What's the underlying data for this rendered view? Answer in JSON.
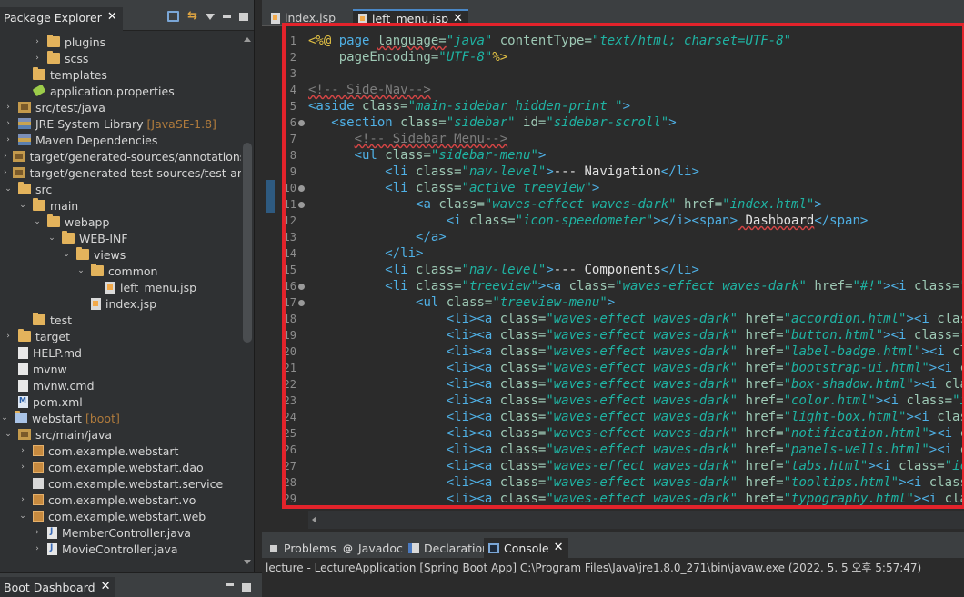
{
  "package_explorer": {
    "title": "Package Explorer",
    "tree": [
      {
        "label": "plugins",
        "suffix": "",
        "icon": "folder"
      },
      {
        "label": "scss",
        "suffix": "",
        "icon": "folder"
      },
      {
        "label": "templates",
        "suffix": "",
        "icon": "folder"
      },
      {
        "label": "application.properties",
        "suffix": "",
        "icon": "properties"
      },
      {
        "label": "src/test/java",
        "suffix": "",
        "icon": "source-folder"
      },
      {
        "label": "JRE System Library",
        "suffix": "[JavaSE-1.8]",
        "icon": "library"
      },
      {
        "label": "Maven Dependencies",
        "suffix": "",
        "icon": "library"
      },
      {
        "label": "target/generated-sources/annotations",
        "suffix": "",
        "icon": "source-folder"
      },
      {
        "label": "target/generated-test-sources/test-annotat",
        "suffix": "",
        "icon": "source-folder"
      },
      {
        "label": "src",
        "suffix": "",
        "icon": "folder"
      },
      {
        "label": "main",
        "suffix": "",
        "icon": "folder"
      },
      {
        "label": "webapp",
        "suffix": "",
        "icon": "folder"
      },
      {
        "label": "WEB-INF",
        "suffix": "",
        "icon": "folder"
      },
      {
        "label": "views",
        "suffix": "",
        "icon": "folder"
      },
      {
        "label": "common",
        "suffix": "",
        "icon": "folder"
      },
      {
        "label": "left_menu.jsp",
        "suffix": "",
        "icon": "jsp-file"
      },
      {
        "label": "index.jsp",
        "suffix": "",
        "icon": "jsp-file"
      },
      {
        "label": "test",
        "suffix": "",
        "icon": "folder"
      },
      {
        "label": "target",
        "suffix": "",
        "icon": "folder"
      },
      {
        "label": "HELP.md",
        "suffix": "",
        "icon": "file"
      },
      {
        "label": "mvnw",
        "suffix": "",
        "icon": "file"
      },
      {
        "label": "mvnw.cmd",
        "suffix": "",
        "icon": "file"
      },
      {
        "label": "pom.xml",
        "suffix": "",
        "icon": "xml-file"
      },
      {
        "label": "webstart",
        "suffix": "[boot]",
        "icon": "project"
      },
      {
        "label": "src/main/java",
        "suffix": "",
        "icon": "source-folder"
      },
      {
        "label": "com.example.webstart",
        "suffix": "",
        "icon": "package"
      },
      {
        "label": "com.example.webstart.dao",
        "suffix": "",
        "icon": "package"
      },
      {
        "label": "com.example.webstart.service",
        "suffix": "",
        "icon": "package-white"
      },
      {
        "label": "com.example.webstart.vo",
        "suffix": "",
        "icon": "package"
      },
      {
        "label": "com.example.webstart.web",
        "suffix": "",
        "icon": "package"
      },
      {
        "label": "MemberController.java",
        "suffix": "",
        "icon": "java-file"
      },
      {
        "label": "MovieController.java",
        "suffix": "",
        "icon": "java-file"
      }
    ]
  },
  "boot_dashboard": {
    "title": "Boot Dashboard"
  },
  "editor": {
    "tabs": [
      {
        "label": "index.jsp",
        "active": false
      },
      {
        "label": "left_menu.jsp",
        "active": true
      }
    ],
    "line_numbers": [
      "1",
      "2",
      "3",
      "4",
      "5",
      "6",
      "7",
      "8",
      "9",
      "10",
      "11",
      "12",
      "13",
      "14",
      "15",
      "16",
      "17",
      "18",
      "19",
      "20",
      "21",
      "22",
      "23",
      "24",
      "25",
      "26",
      "27",
      "28",
      "29"
    ],
    "lines": [
      [
        [
          "dir",
          "<%@ "
        ],
        [
          "kw",
          "page "
        ],
        [
          "attr",
          "language="
        ],
        [
          "val",
          "\"java\" "
        ],
        [
          "attr",
          "contentType="
        ],
        [
          "val",
          "\"text/html; charset=UTF-8\""
        ]
      ],
      [
        [
          "text",
          "    "
        ],
        [
          "attr",
          "pageEncoding="
        ],
        [
          "val",
          "\"UTF-8\""
        ],
        [
          "dir",
          "%>"
        ]
      ],
      [],
      [
        [
          "cmt",
          "<!-- Side-Nav-->"
        ]
      ],
      [
        [
          "tag",
          "<aside "
        ],
        [
          "attr",
          "class="
        ],
        [
          "val",
          "\"main-sidebar hidden-print \""
        ],
        [
          "tag",
          ">"
        ]
      ],
      [
        [
          "text",
          "   "
        ],
        [
          "tag",
          "<section "
        ],
        [
          "attr",
          "class="
        ],
        [
          "val",
          "\"sidebar\" "
        ],
        [
          "attr",
          "id="
        ],
        [
          "val",
          "\"sidebar-scroll\""
        ],
        [
          "tag",
          ">"
        ]
      ],
      [
        [
          "text",
          "      "
        ],
        [
          "cmt",
          "<!-- Sidebar Menu-->"
        ]
      ],
      [
        [
          "text",
          "      "
        ],
        [
          "tag",
          "<ul "
        ],
        [
          "attr",
          "class="
        ],
        [
          "val",
          "\"sidebar-menu\""
        ],
        [
          "tag",
          ">"
        ]
      ],
      [
        [
          "text",
          "          "
        ],
        [
          "tag",
          "<li "
        ],
        [
          "attr",
          "class="
        ],
        [
          "val",
          "\"nav-level\""
        ],
        [
          "tag",
          ">"
        ],
        [
          "text",
          "--- Navigation"
        ],
        [
          "tag",
          "</li>"
        ]
      ],
      [
        [
          "text",
          "          "
        ],
        [
          "tag",
          "<li "
        ],
        [
          "attr",
          "class="
        ],
        [
          "val",
          "\"active treeview\""
        ],
        [
          "tag",
          ">"
        ]
      ],
      [
        [
          "text",
          "              "
        ],
        [
          "tag",
          "<a "
        ],
        [
          "attr",
          "class="
        ],
        [
          "val",
          "\"waves-effect waves-dark\" "
        ],
        [
          "attr",
          "href="
        ],
        [
          "val",
          "\"index.html\""
        ],
        [
          "tag",
          ">"
        ]
      ],
      [
        [
          "text",
          "                  "
        ],
        [
          "tag",
          "<i "
        ],
        [
          "attr",
          "class="
        ],
        [
          "val",
          "\"icon-speedometer\""
        ],
        [
          "tag",
          "></i><span>"
        ],
        [
          "text",
          " Dashboard"
        ],
        [
          "tag",
          "</span>"
        ]
      ],
      [
        [
          "text",
          "              "
        ],
        [
          "tag",
          "</a>"
        ]
      ],
      [
        [
          "text",
          "          "
        ],
        [
          "tag",
          "</li>"
        ]
      ],
      [
        [
          "text",
          "          "
        ],
        [
          "tag",
          "<li "
        ],
        [
          "attr",
          "class="
        ],
        [
          "val",
          "\"nav-level\""
        ],
        [
          "tag",
          ">"
        ],
        [
          "text",
          "--- Components"
        ],
        [
          "tag",
          "</li>"
        ]
      ],
      [
        [
          "text",
          "          "
        ],
        [
          "tag",
          "<li "
        ],
        [
          "attr",
          "class="
        ],
        [
          "val",
          "\"treeview\""
        ],
        [
          "tag",
          "><a "
        ],
        [
          "attr",
          "class="
        ],
        [
          "val",
          "\"waves-effect waves-dark\" "
        ],
        [
          "attr",
          "href="
        ],
        [
          "val",
          "\"#!\""
        ],
        [
          "tag",
          "><i "
        ],
        [
          "attr",
          "class="
        ],
        [
          "val",
          "\"icon-"
        ]
      ],
      [
        [
          "text",
          "              "
        ],
        [
          "tag",
          "<ul "
        ],
        [
          "attr",
          "class="
        ],
        [
          "val",
          "\"treeview-menu\""
        ],
        [
          "tag",
          ">"
        ]
      ],
      [
        [
          "text",
          "                  "
        ],
        [
          "tag",
          "<li><a "
        ],
        [
          "attr",
          "class="
        ],
        [
          "val",
          "\"waves-effect waves-dark\" "
        ],
        [
          "attr",
          "href="
        ],
        [
          "val",
          "\"accordion.html\""
        ],
        [
          "tag",
          "><i "
        ],
        [
          "attr",
          "class="
        ],
        [
          "val",
          "\"i"
        ]
      ],
      [
        [
          "text",
          "                  "
        ],
        [
          "tag",
          "<li><a "
        ],
        [
          "attr",
          "class="
        ],
        [
          "val",
          "\"waves-effect waves-dark\" "
        ],
        [
          "attr",
          "href="
        ],
        [
          "val",
          "\"button.html\""
        ],
        [
          "tag",
          "><i "
        ],
        [
          "attr",
          "class="
        ],
        [
          "val",
          "\"icon-"
        ]
      ],
      [
        [
          "text",
          "                  "
        ],
        [
          "tag",
          "<li><a "
        ],
        [
          "attr",
          "class="
        ],
        [
          "val",
          "\"waves-effect waves-dark\" "
        ],
        [
          "attr",
          "href="
        ],
        [
          "val",
          "\"label-badge.html\""
        ],
        [
          "tag",
          "><i "
        ],
        [
          "attr",
          "class="
        ]
      ],
      [
        [
          "text",
          "                  "
        ],
        [
          "tag",
          "<li><a "
        ],
        [
          "attr",
          "class="
        ],
        [
          "val",
          "\"waves-effect waves-dark\" "
        ],
        [
          "attr",
          "href="
        ],
        [
          "val",
          "\"bootstrap-ui.html\""
        ],
        [
          "tag",
          "><i "
        ],
        [
          "attr",
          "class"
        ]
      ],
      [
        [
          "text",
          "                  "
        ],
        [
          "tag",
          "<li><a "
        ],
        [
          "attr",
          "class="
        ],
        [
          "val",
          "\"waves-effect waves-dark\" "
        ],
        [
          "attr",
          "href="
        ],
        [
          "val",
          "\"box-shadow.html\""
        ],
        [
          "tag",
          "><i "
        ],
        [
          "attr",
          "class="
        ],
        [
          "val",
          "\""
        ]
      ],
      [
        [
          "text",
          "                  "
        ],
        [
          "tag",
          "<li><a "
        ],
        [
          "attr",
          "class="
        ],
        [
          "val",
          "\"waves-effect waves-dark\" "
        ],
        [
          "attr",
          "href="
        ],
        [
          "val",
          "\"color.html\""
        ],
        [
          "tag",
          "><i "
        ],
        [
          "attr",
          "class="
        ],
        [
          "val",
          "\"icon-"
        ]
      ],
      [
        [
          "text",
          "                  "
        ],
        [
          "tag",
          "<li><a "
        ],
        [
          "attr",
          "class="
        ],
        [
          "val",
          "\"waves-effect waves-dark\" "
        ],
        [
          "attr",
          "href="
        ],
        [
          "val",
          "\"light-box.html\""
        ],
        [
          "tag",
          "><i "
        ],
        [
          "attr",
          "class="
        ],
        [
          "val",
          "\"i"
        ]
      ],
      [
        [
          "text",
          "                  "
        ],
        [
          "tag",
          "<li><a "
        ],
        [
          "attr",
          "class="
        ],
        [
          "val",
          "\"waves-effect waves-dark\" "
        ],
        [
          "attr",
          "href="
        ],
        [
          "val",
          "\"notification.html\""
        ],
        [
          "tag",
          "><i "
        ],
        [
          "attr",
          "class"
        ]
      ],
      [
        [
          "text",
          "                  "
        ],
        [
          "tag",
          "<li><a "
        ],
        [
          "attr",
          "class="
        ],
        [
          "val",
          "\"waves-effect waves-dark\" "
        ],
        [
          "attr",
          "href="
        ],
        [
          "val",
          "\"panels-wells.html\""
        ],
        [
          "tag",
          "><i "
        ],
        [
          "attr",
          "class"
        ]
      ],
      [
        [
          "text",
          "                  "
        ],
        [
          "tag",
          "<li><a "
        ],
        [
          "attr",
          "class="
        ],
        [
          "val",
          "\"waves-effect waves-dark\" "
        ],
        [
          "attr",
          "href="
        ],
        [
          "val",
          "\"tabs.html\""
        ],
        [
          "tag",
          "><i "
        ],
        [
          "attr",
          "class="
        ],
        [
          "val",
          "\"icon-a"
        ]
      ],
      [
        [
          "text",
          "                  "
        ],
        [
          "tag",
          "<li><a "
        ],
        [
          "attr",
          "class="
        ],
        [
          "val",
          "\"waves-effect waves-dark\" "
        ],
        [
          "attr",
          "href="
        ],
        [
          "val",
          "\"tooltips.html\""
        ],
        [
          "tag",
          "><i "
        ],
        [
          "attr",
          "class="
        ],
        [
          "val",
          "\"ic"
        ]
      ],
      [
        [
          "text",
          "                  "
        ],
        [
          "tag",
          "<li><a "
        ],
        [
          "attr",
          "class="
        ],
        [
          "val",
          "\"waves-effect waves-dark\" "
        ],
        [
          "attr",
          "href="
        ],
        [
          "val",
          "\"typography.html\""
        ],
        [
          "tag",
          "><i "
        ],
        [
          "attr",
          "class="
        ]
      ]
    ]
  },
  "console": {
    "tabs": [
      {
        "label": "Problems",
        "icon": "problems-icon"
      },
      {
        "label": "Javadoc",
        "icon": "javadoc-icon"
      },
      {
        "label": "Declaration",
        "icon": "declaration-icon"
      },
      {
        "label": "Console",
        "icon": "console-icon"
      }
    ],
    "status": "lecture - LectureApplication [Spring Boot App] C:\\Program Files\\Java\\jre1.8.0_271\\bin\\javaw.exe  (2022. 5. 5 오후 5:57:47)"
  },
  "colors": {
    "highlight_border": "#e3232b",
    "editor_bg": "#2b2b2b",
    "panel_bg": "#3c3f41"
  }
}
